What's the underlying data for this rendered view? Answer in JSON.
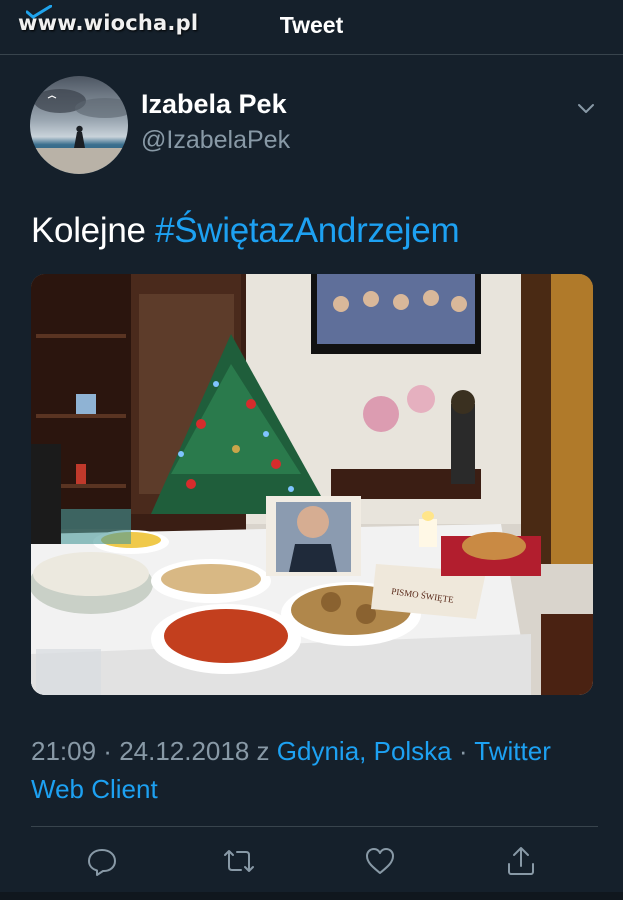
{
  "watermark": {
    "text": "www.wiocha.pl"
  },
  "header": {
    "title": "Tweet"
  },
  "tweet": {
    "author": {
      "display_name": "Izabela Pek",
      "handle": "@IzabelaPek"
    },
    "text_plain": "Kolejne ",
    "hashtag": "#ŚwiętazAndrzejem",
    "photo": {
      "book_cover_text": "PISMO ŚWIĘTE"
    },
    "meta": {
      "time": "21:09",
      "sep1": " · ",
      "date": "24.12.2018",
      "from": " z ",
      "location": "Gdynia, Polska",
      "sep2": " · ",
      "client": "Twitter Web Client"
    },
    "actions": {
      "reply": "reply-icon",
      "retweet": "retweet-icon",
      "like": "heart-icon",
      "share": "share-icon"
    }
  },
  "colors": {
    "background": "#15202b",
    "accent": "#1da1f2",
    "secondary_text": "#8899a6",
    "divider": "#38444d"
  }
}
